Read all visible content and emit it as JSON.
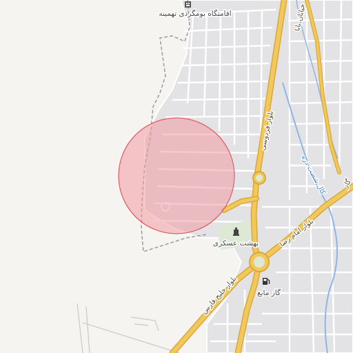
{
  "map": {
    "colors": {
      "background": "#f6f4f0",
      "street": "#ffffff",
      "block": "#e2e2e4",
      "arterial": "#f2c75c",
      "arterial_casing": "#d8a93a",
      "water": "#8fb4e6",
      "boundary": "#999999",
      "park": "#dde9d5",
      "circle_fill": "#f09aa3",
      "circle_stroke": "#e05a66"
    },
    "labels": [
      {
        "id": "hotel",
        "text": "اقامتگاه بومگردی تهمینه",
        "icon": "hotel-icon"
      },
      {
        "id": "cemetery",
        "text": "بهشت عسکری",
        "icon": "cemetery-icon"
      },
      {
        "id": "gas",
        "text": "گاز مایع",
        "icon": "fuel-icon"
      }
    ],
    "roads": [
      {
        "id": "ferdowsi",
        "text": "بلوار فردوسی"
      },
      {
        "id": "imam-reza",
        "text": "بلوار امام رضا"
      },
      {
        "id": "persian-gulf",
        "text": "بلوار خلیج فارس"
      },
      {
        "id": "top-right",
        "text": "خیابان بابا"
      },
      {
        "id": "right-edge",
        "text": "گاز"
      }
    ],
    "water": [
      {
        "id": "canal",
        "text": "کال شصت دره"
      }
    ],
    "highlight": {
      "shape": "circle"
    }
  }
}
